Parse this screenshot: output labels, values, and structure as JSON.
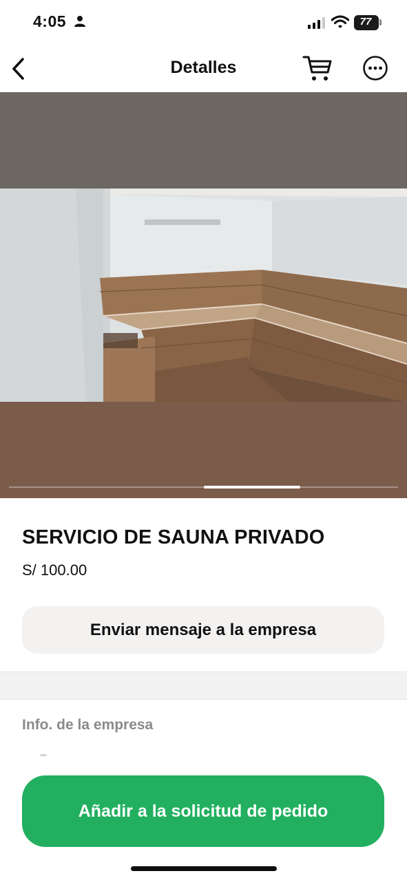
{
  "status_bar": {
    "time": "4:05",
    "battery": "77",
    "icons": [
      "person-icon",
      "signal-icon",
      "wifi-icon",
      "battery-icon"
    ]
  },
  "nav": {
    "title": "Detalles",
    "icons": [
      "chevron-left-icon",
      "cart-icon",
      "more-icon"
    ]
  },
  "gallery": {
    "slides": 4,
    "active_index": 2,
    "image": "sauna-room-photo"
  },
  "product": {
    "title": "SERVICIO DE SAUNA PRIVADO",
    "price": "S/ 100.00"
  },
  "actions": {
    "message_label": "Enviar mensaje a la empresa",
    "order_label": "Añadir a la solicitud de pedido"
  },
  "company": {
    "section_label": "Info. de la empresa"
  },
  "colors": {
    "accent_green": "#22b060",
    "secondary_button": "#f3f2f1",
    "muted_text": "#8a8a8a"
  }
}
